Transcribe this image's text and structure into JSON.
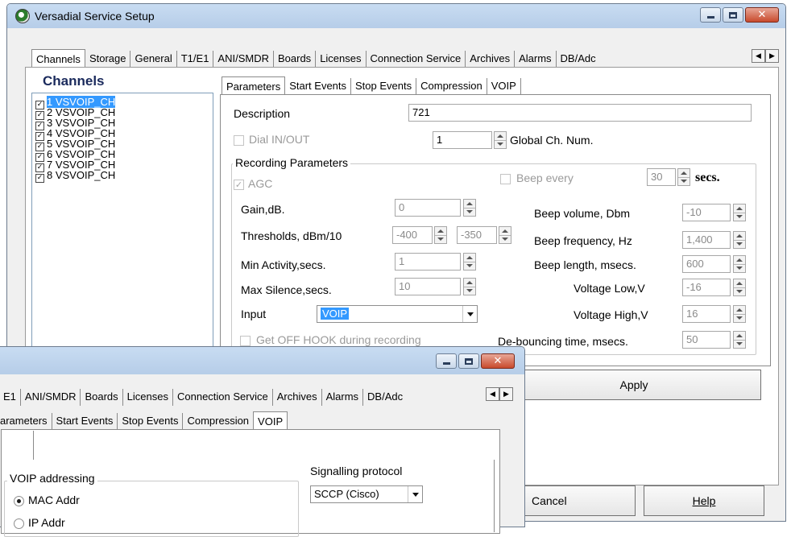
{
  "main_window": {
    "title": "Versadial Service Setup",
    "tabs": [
      "Channels",
      "Storage",
      "General",
      "T1/E1",
      "ANI/SMDR",
      "Boards",
      "Licenses",
      "Connection Service",
      "Archives",
      "Alarms",
      "DB/Adc"
    ],
    "active_tab": "Channels",
    "channels": {
      "heading": "Channels",
      "items": [
        {
          "label": "1 VSVOIP_CH",
          "checked": true,
          "selected": true
        },
        {
          "label": "2 VSVOIP_CH",
          "checked": true
        },
        {
          "label": "3 VSVOIP_CH",
          "checked": true
        },
        {
          "label": "4 VSVOIP_CH",
          "checked": true
        },
        {
          "label": "5 VSVOIP_CH",
          "checked": true
        },
        {
          "label": "6 VSVOIP_CH",
          "checked": true
        },
        {
          "label": "7 VSVOIP_CH",
          "checked": true
        },
        {
          "label": "8 VSVOIP_CH",
          "checked": true
        }
      ]
    },
    "subtabs": [
      "Parameters",
      "Start Events",
      "Stop Events",
      "Compression",
      "VOIP"
    ],
    "active_subtab": "Parameters",
    "params": {
      "description_label": "Description",
      "description_value": "721",
      "dial_label": "Dial IN/OUT",
      "global_ch_value": "1",
      "global_ch_label": "Global Ch. Num.",
      "recording_group": "Recording Parameters",
      "agc_label": "AGC",
      "beep_every_label": "Beep every",
      "beep_every_value": "30",
      "secs_label": "secs.",
      "gain_label": "Gain,dB.",
      "gain_value": "0",
      "thresholds_label": "Thresholds, dBm/10",
      "threshold_low": "-400",
      "threshold_high": "-350",
      "min_activity_label": "Min Activity,secs.",
      "min_activity_value": "1",
      "max_silence_label": "Max Silence,secs.",
      "max_silence_value": "10",
      "input_label": "Input",
      "input_value": "VOIP",
      "offhook_label": "Get OFF HOOK during recording",
      "beep_volume_label": "Beep volume, Dbm",
      "beep_volume_value": "-10",
      "beep_freq_label": "Beep frequency, Hz",
      "beep_freq_value": "1,400",
      "beep_length_label": "Beep length, msecs.",
      "beep_length_value": "600",
      "voltage_low_label": "Voltage Low,V",
      "voltage_low_value": "-16",
      "voltage_high_label": "Voltage High,V",
      "voltage_high_value": "16",
      "debounce_label": "De-bouncing time, msecs.",
      "debounce_value": "50"
    },
    "apply_label": "Apply",
    "cancel_label": "Cancel",
    "help_label": "Help"
  },
  "second_window": {
    "tabs": [
      "E1",
      "ANI/SMDR",
      "Boards",
      "Licenses",
      "Connection Service",
      "Archives",
      "Alarms",
      "DB/Adc"
    ],
    "subtabs": [
      "arameters",
      "Start Events",
      "Stop Events",
      "Compression",
      "VOIP"
    ],
    "active_subtab": "VOIP",
    "voip_addressing_label": "VOIP addressing",
    "mac_addr_label": "MAC Addr",
    "ip_addr_label": "IP Addr",
    "signalling_label": "Signalling protocol",
    "signalling_value": "SCCP (Cisco)"
  }
}
